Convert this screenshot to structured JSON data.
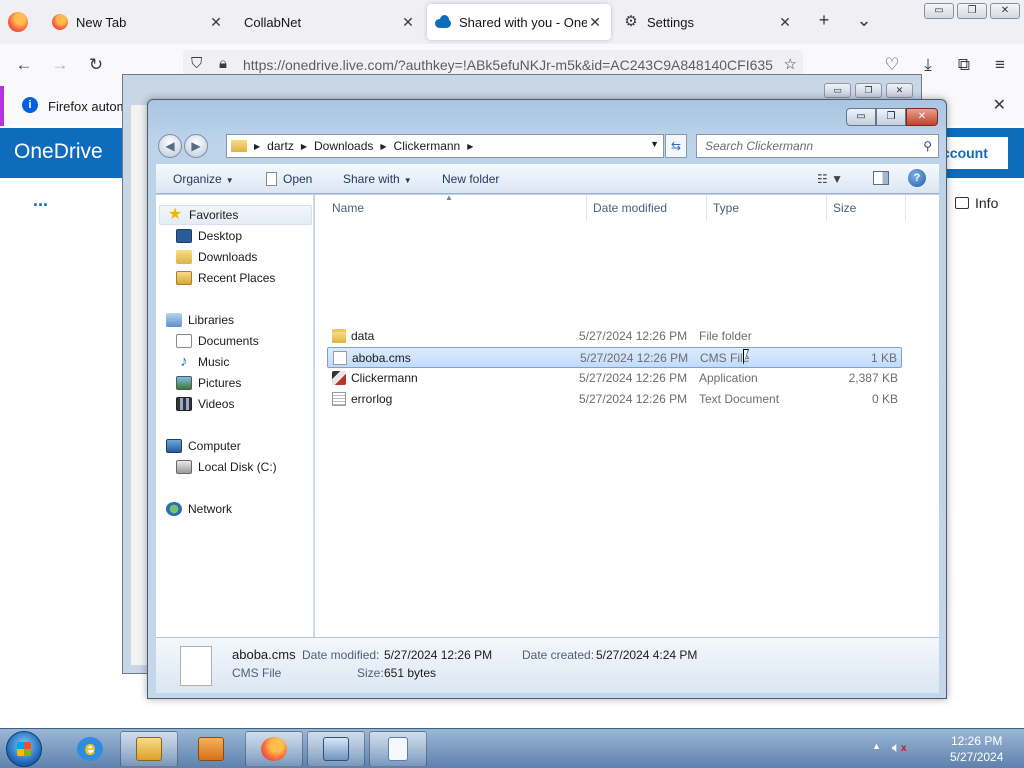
{
  "browser": {
    "tabs": [
      {
        "label": "New Tab"
      },
      {
        "label": "CollabNet"
      },
      {
        "label": "Shared with you - OneDrive"
      },
      {
        "label": "Settings"
      }
    ],
    "url": "https://onedrive.live.com/?authkey=!ABk5efuNKJr-m5k&id=AC243C9A848140CFI635",
    "notification": "Firefox automa",
    "onedrive": {
      "brand": "OneDrive",
      "account_label": "ccount",
      "more": "...",
      "info_label": "Info"
    }
  },
  "explorer": {
    "breadcrumb": [
      "dartz",
      "Downloads",
      "Clickermann"
    ],
    "search_placeholder": "Search Clickermann",
    "toolbar": {
      "organize": "Organize",
      "open": "Open",
      "share_with": "Share with",
      "new_folder": "New folder"
    },
    "nav": {
      "favorites": "Favorites",
      "desktop": "Desktop",
      "downloads": "Downloads",
      "recent_places": "Recent Places",
      "libraries": "Libraries",
      "documents": "Documents",
      "music": "Music",
      "pictures": "Pictures",
      "videos": "Videos",
      "computer": "Computer",
      "local_disk": "Local Disk (C:)",
      "network": "Network"
    },
    "columns": {
      "name": "Name",
      "date": "Date modified",
      "type": "Type",
      "size": "Size"
    },
    "files": [
      {
        "name": "data",
        "date": "5/27/2024 12:26 PM",
        "type": "File folder",
        "size": "",
        "icon": "folder-icon"
      },
      {
        "name": "aboba.cms",
        "date": "5/27/2024 12:26 PM",
        "type": "CMS File",
        "size": "1 KB",
        "icon": "file-icon",
        "selected": true
      },
      {
        "name": "Clickermann",
        "date": "5/27/2024 12:26 PM",
        "type": "Application",
        "size": "2,387 KB",
        "icon": "application-icon"
      },
      {
        "name": "errorlog",
        "date": "5/27/2024 12:26 PM",
        "type": "Text Document",
        "size": "0 KB",
        "icon": "text-file-icon"
      }
    ],
    "details": {
      "name": "aboba.cms",
      "type": "CMS File",
      "modified_label": "Date modified:",
      "modified_value": "5/27/2024 12:26 PM",
      "created_label": "Date created:",
      "created_value": "5/27/2024 4:24 PM",
      "size_label": "Size:",
      "size_value": "651 bytes"
    }
  },
  "taskbar": {
    "clock_time": "12:26 PM",
    "clock_date": "5/27/2024"
  },
  "colors": {
    "onedrive_blue": "#0f6cbd",
    "selection": "#c1dbfc",
    "notification_accent": "#b833e1"
  }
}
